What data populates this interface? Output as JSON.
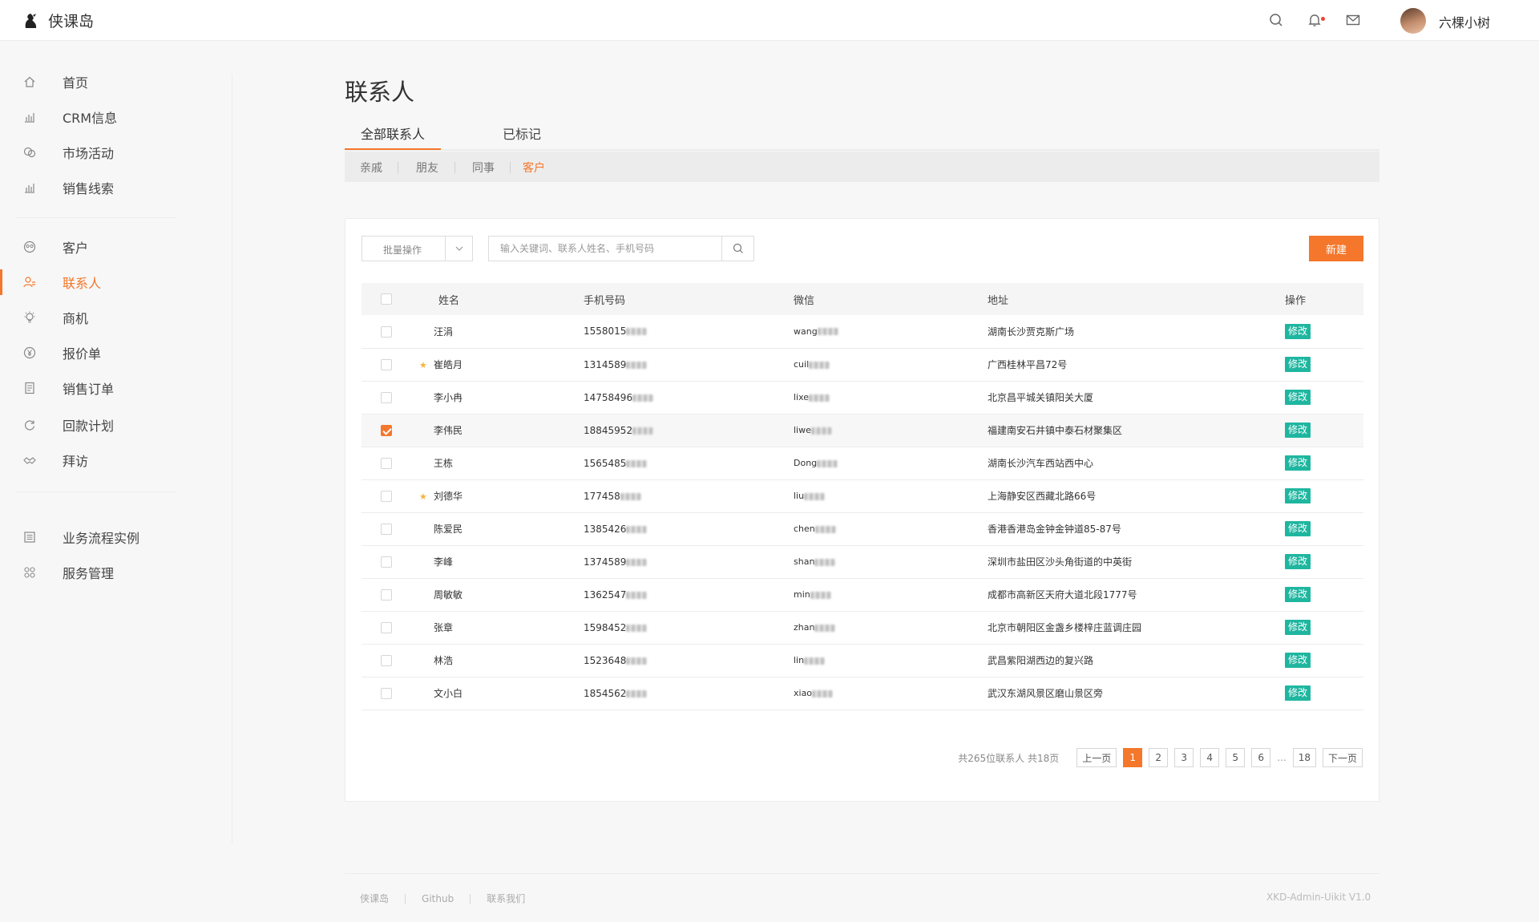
{
  "brand": {
    "name": "侠课岛"
  },
  "header": {
    "user_name": "六棵小树",
    "icons": [
      "search-icon",
      "bell-icon",
      "mail-icon"
    ]
  },
  "sidebar": {
    "groups": [
      [
        {
          "label": "首页",
          "icon": "home-icon"
        },
        {
          "label": "CRM信息",
          "icon": "bar-chart-icon"
        },
        {
          "label": "市场活动",
          "icon": "chat-bubbles-icon"
        },
        {
          "label": "销售线索",
          "icon": "bar-chart-icon"
        }
      ],
      [
        {
          "label": "客户",
          "icon": "customers-icon"
        },
        {
          "label": "联系人",
          "icon": "contacts-icon",
          "active": true
        },
        {
          "label": "商机",
          "icon": "lightbulb-icon"
        },
        {
          "label": "报价单",
          "icon": "yen-icon"
        },
        {
          "label": "销售订单",
          "icon": "document-icon"
        },
        {
          "label": "回款计划",
          "icon": "refresh-icon"
        },
        {
          "label": "拜访",
          "icon": "handshake-icon"
        }
      ],
      [
        {
          "label": "业务流程实例",
          "icon": "list-icon"
        },
        {
          "label": "服务管理",
          "icon": "grid-icon"
        }
      ]
    ]
  },
  "page": {
    "title": "联系人",
    "tabs": [
      {
        "label": "全部联系人",
        "active": true
      },
      {
        "label": "已标记"
      }
    ],
    "subtabs": [
      {
        "label": "亲戚"
      },
      {
        "label": "朋友"
      },
      {
        "label": "同事"
      },
      {
        "label": "客户",
        "active": true
      }
    ]
  },
  "toolbar": {
    "batch_label": "批量操作",
    "search_placeholder": "输入关键词、联系人姓名、手机号码",
    "new_label": "新建"
  },
  "table": {
    "columns": [
      "姓名",
      "手机号码",
      "微信",
      "地址",
      "操作"
    ],
    "action_label": "修改",
    "rows": [
      {
        "name": "汪涓",
        "phone": "1558015",
        "wechat": "wang",
        "address": "湖南长沙贾克斯广场",
        "starred": false,
        "checked": false
      },
      {
        "name": "崔皓月",
        "phone": "1314589",
        "wechat": "cuil",
        "address": "广西桂林平昌72号",
        "starred": true,
        "checked": false
      },
      {
        "name": "李小冉",
        "phone": "14758496",
        "wechat": "lixe",
        "address": "北京昌平城关镇阳关大厦",
        "starred": false,
        "checked": false
      },
      {
        "name": "李伟民",
        "phone": "18845952",
        "wechat": "liwe",
        "address": "福建南安石井镇中泰石材聚集区",
        "starred": false,
        "checked": true
      },
      {
        "name": "王栋",
        "phone": "1565485",
        "wechat": "Dong",
        "address": "湖南长沙汽车西站西中心",
        "starred": false,
        "checked": false
      },
      {
        "name": "刘德华",
        "phone": "177458",
        "wechat": "liu",
        "address": "上海静安区西藏北路66号",
        "starred": true,
        "checked": false
      },
      {
        "name": "陈爱民",
        "phone": "1385426",
        "wechat": "chen",
        "address": "香港香港岛金钟金钟道85-87号",
        "starred": false,
        "checked": false
      },
      {
        "name": "李峰",
        "phone": "1374589",
        "wechat": "shan",
        "address": "深圳市盐田区沙头角街道的中英街",
        "starred": false,
        "checked": false
      },
      {
        "name": "周敏敏",
        "phone": "1362547",
        "wechat": "min",
        "address": "成都市高新区天府大道北段1777号",
        "starred": false,
        "checked": false
      },
      {
        "name": "张章",
        "phone": "1598452",
        "wechat": "zhan",
        "address": "北京市朝阳区金盏乡楼梓庄蓝调庄园",
        "starred": false,
        "checked": false
      },
      {
        "name": "林浩",
        "phone": "1523648",
        "wechat": "lin",
        "address": "武昌紫阳湖西边的复兴路",
        "starred": false,
        "checked": false
      },
      {
        "name": "文小白",
        "phone": "1854562",
        "wechat": "xiao",
        "address": "武汉东湖风景区磨山景区旁",
        "starred": false,
        "checked": false
      }
    ]
  },
  "pagination": {
    "total_text": "共265位联系人  共18页",
    "prev_label": "上一页",
    "next_label": "下一页",
    "pages": [
      "1",
      "2",
      "3",
      "4",
      "5",
      "6"
    ],
    "ellipsis": "...",
    "last_page": "18",
    "current": "1"
  },
  "footer": {
    "links": [
      "侠课岛",
      "Github",
      "联系我们"
    ],
    "version": "XKD-Admin-Uikit V1.0"
  },
  "colors": {
    "accent": "#f4772b",
    "edit": "#1fb6a0",
    "star": "#f5b342"
  }
}
